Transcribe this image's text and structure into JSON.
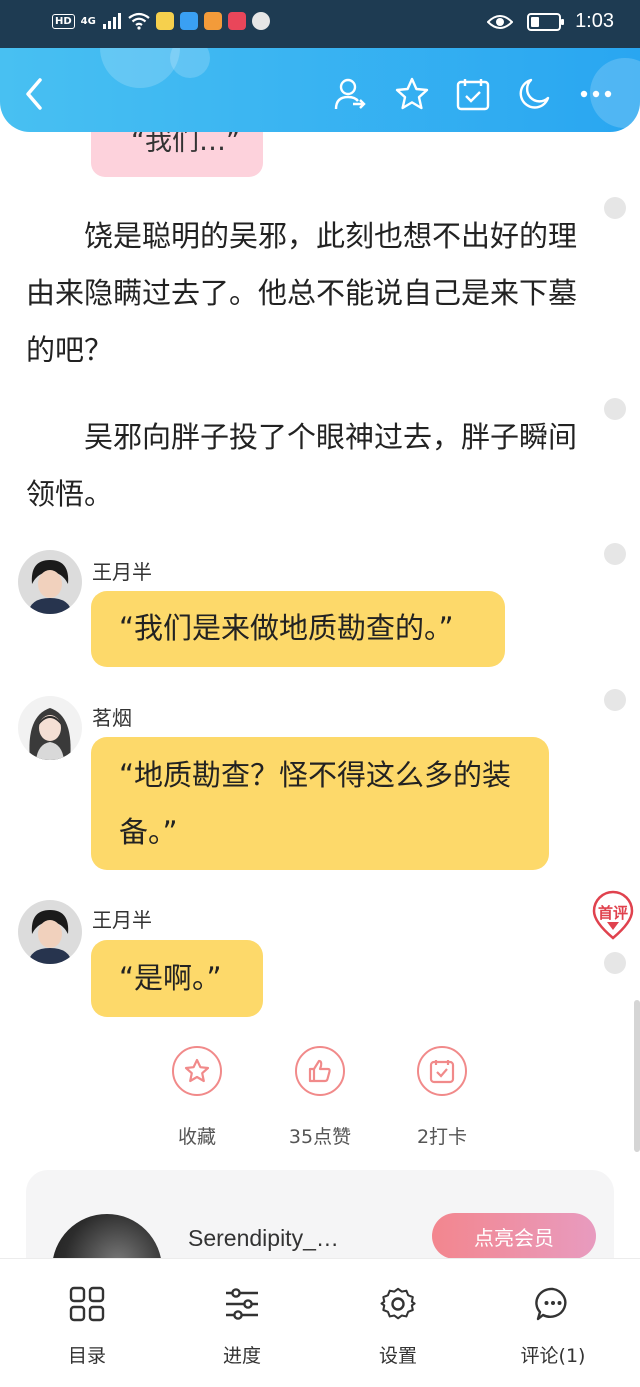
{
  "status_bar": {
    "hd": "HD",
    "signal": "4G",
    "time": "1:03",
    "battery_level": 0.3
  },
  "nav": {
    "icons": [
      "back-icon",
      "author-follow-icon",
      "star-icon",
      "calendar-check-icon",
      "moon-icon",
      "more-icon"
    ]
  },
  "story": {
    "top_bubble_fragment": "“我们…”",
    "paragraphs": [
      "饶是聪明的吴邪，此刻也想不出好的理由来隐瞒过去了。他总不能说自己是来下墓的吧？",
      "吴邪向胖子投了个眼神过去，胖子瞬间领悟。"
    ],
    "dialogues": [
      {
        "speaker": "王月半",
        "text": "“我们是来做地质勘查的。”"
      },
      {
        "speaker": "茗烟",
        "text": "“地质勘查？怪不得这么多的装备。”"
      },
      {
        "speaker": "王月半",
        "text": "“是啊。”"
      }
    ],
    "first_comment_badge": "首评"
  },
  "actions": [
    {
      "label": "收藏",
      "icon": "star-icon"
    },
    {
      "label": "35点赞",
      "icon": "thumbs-up-icon"
    },
    {
      "label": "2打卡",
      "icon": "checkin-icon"
    }
  ],
  "author": {
    "name": "Serendipity_…",
    "vip_button": "点亮会员"
  },
  "bottom_tabs": [
    {
      "label": "目录",
      "icon": "grid-icon"
    },
    {
      "label": "进度",
      "icon": "sliders-icon"
    },
    {
      "label": "设置",
      "icon": "gear-icon"
    },
    {
      "label": "评论(1)",
      "icon": "comment-icon"
    }
  ],
  "colors": {
    "nav_gradient_start": "#48c0f2",
    "nav_gradient_end": "#29a6f1",
    "dialogue_bubble": "#fdd96a",
    "pink_bubble": "#fdd2dc",
    "accent_red": "#f18a8a"
  }
}
